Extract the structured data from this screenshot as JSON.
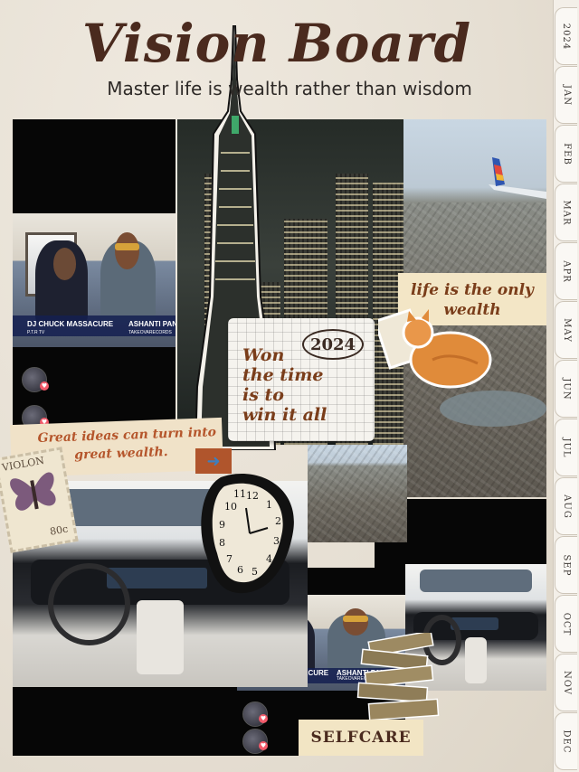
{
  "header": {
    "title": "Vision Board",
    "subtitle": "Master life is wealth rather than wisdom"
  },
  "tabs": [
    "2024",
    "JAN",
    "FEB",
    "MAR",
    "APR",
    "MAY",
    "JUN",
    "JUL",
    "AUG",
    "SEP",
    "OCT",
    "NOV",
    "DEC"
  ],
  "podcast": {
    "host1": "DJ CHUCK MASSACURE",
    "host1_sub": "P.T.R TV",
    "host2": "ASHANTI PAN",
    "host2_sub": "TAKEOVARECORDS"
  },
  "notes": {
    "wealth_note": "life is the only wealth",
    "year": "2024",
    "won_line1": "Won",
    "won_line2": "the time",
    "won_line3": "is to",
    "won_line4": "win it all",
    "ideas_line1": "Great ideas can turn into",
    "ideas_line2": "great wealth.",
    "selfcare": "SELFCARE",
    "stamp_word": "VIOLON",
    "stamp_value": "80c"
  },
  "colors": {
    "title": "#4a2a1e",
    "note_text": "#7a3d1a",
    "arrow_tag": "#b0552c",
    "heart": "#f25a6a"
  }
}
